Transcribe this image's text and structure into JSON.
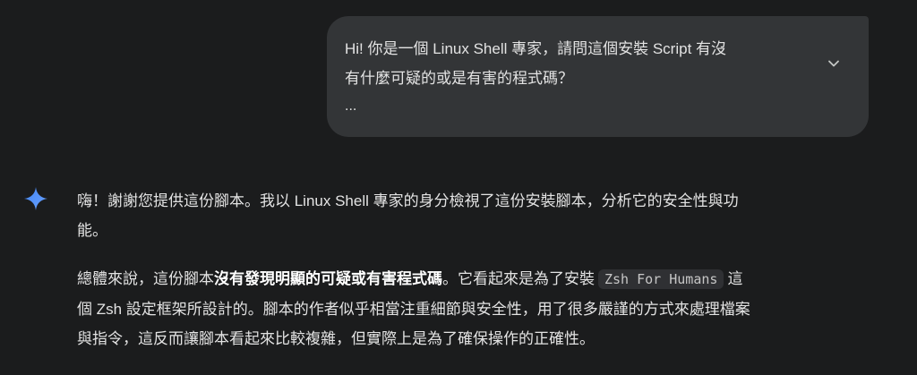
{
  "user_message": {
    "lines": [
      "Hi! 你是一個 Linux Shell 專家，請問這個安裝 Script 有沒",
      "有什麼可疑的或是有害的程式碼？"
    ],
    "truncation": "...",
    "expand_icon": "chevron-down-icon"
  },
  "assistant": {
    "icon": "gemini-sparkle-icon",
    "accent_colors": [
      "#4285f4",
      "#9b72cb"
    ],
    "paragraph1": {
      "line1": "嗨！謝謝您提供這份腳本。我以 Linux Shell 專家的身分檢視了這份安裝腳本，分析它的安全性與功",
      "line2": "能。"
    },
    "paragraph2": {
      "line1_pre": "總體來說，這份腳本",
      "line1_bold": "沒有發現明顯的可疑或有害程式碼",
      "line1_mid": "。它看起來是為了安裝",
      "line1_code": "Zsh For Humans",
      "line1_post": "這",
      "line2": "個 Zsh 設定框架所設計的。腳本的作者似乎相當注重細節與安全性，用了很多嚴謹的方式來處理檔案",
      "line3": "與指令，這反而讓腳本看起來比較複雜，但實際上是為了確保操作的正確性。"
    }
  }
}
